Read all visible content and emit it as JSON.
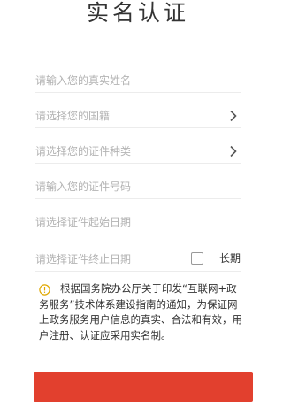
{
  "header": {
    "title": "实名认证"
  },
  "form": {
    "name": {
      "placeholder": "请输入您的真实姓名"
    },
    "nationality": {
      "placeholder": "请选择您的国籍"
    },
    "id_type": {
      "placeholder": "请选择您的证件种类"
    },
    "id_number": {
      "placeholder": "请输入您的证件号码"
    },
    "start_date": {
      "placeholder": "请选择证件起始日期"
    },
    "end_date": {
      "placeholder": "请选择证件终止日期"
    },
    "long_term": {
      "label": "长期",
      "checked": false
    }
  },
  "notice": {
    "text": "根据国务院办公厅关于印发“互联网+政务服务”技术体系建设指南的通知，为保证网上政务服务用户信息的真实、合法和有效，用户注册、认证应采用实名制。"
  },
  "submit": {
    "label": ""
  },
  "colors": {
    "accent": "#e2402e",
    "warning_icon": "#e0a800"
  },
  "icons": {
    "chevron": "chevron-right-icon",
    "notice": "warning-icon"
  }
}
